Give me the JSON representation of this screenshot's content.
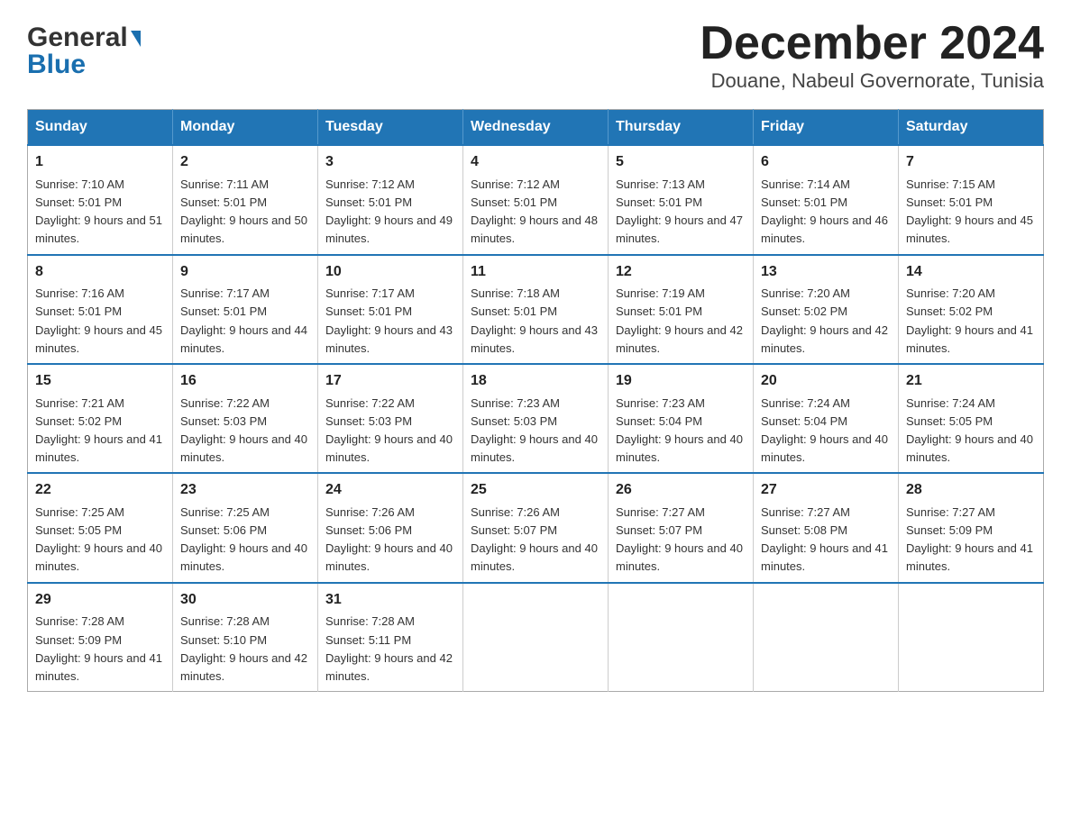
{
  "logo": {
    "line1": "General",
    "arrow": "▶",
    "line2": "Blue"
  },
  "title": "December 2024",
  "subtitle": "Douane, Nabeul Governorate, Tunisia",
  "weekdays": [
    "Sunday",
    "Monday",
    "Tuesday",
    "Wednesday",
    "Thursday",
    "Friday",
    "Saturday"
  ],
  "weeks": [
    [
      {
        "day": "1",
        "sunrise": "7:10 AM",
        "sunset": "5:01 PM",
        "daylight": "9 hours and 51 minutes."
      },
      {
        "day": "2",
        "sunrise": "7:11 AM",
        "sunset": "5:01 PM",
        "daylight": "9 hours and 50 minutes."
      },
      {
        "day": "3",
        "sunrise": "7:12 AM",
        "sunset": "5:01 PM",
        "daylight": "9 hours and 49 minutes."
      },
      {
        "day": "4",
        "sunrise": "7:12 AM",
        "sunset": "5:01 PM",
        "daylight": "9 hours and 48 minutes."
      },
      {
        "day": "5",
        "sunrise": "7:13 AM",
        "sunset": "5:01 PM",
        "daylight": "9 hours and 47 minutes."
      },
      {
        "day": "6",
        "sunrise": "7:14 AM",
        "sunset": "5:01 PM",
        "daylight": "9 hours and 46 minutes."
      },
      {
        "day": "7",
        "sunrise": "7:15 AM",
        "sunset": "5:01 PM",
        "daylight": "9 hours and 45 minutes."
      }
    ],
    [
      {
        "day": "8",
        "sunrise": "7:16 AM",
        "sunset": "5:01 PM",
        "daylight": "9 hours and 45 minutes."
      },
      {
        "day": "9",
        "sunrise": "7:17 AM",
        "sunset": "5:01 PM",
        "daylight": "9 hours and 44 minutes."
      },
      {
        "day": "10",
        "sunrise": "7:17 AM",
        "sunset": "5:01 PM",
        "daylight": "9 hours and 43 minutes."
      },
      {
        "day": "11",
        "sunrise": "7:18 AM",
        "sunset": "5:01 PM",
        "daylight": "9 hours and 43 minutes."
      },
      {
        "day": "12",
        "sunrise": "7:19 AM",
        "sunset": "5:01 PM",
        "daylight": "9 hours and 42 minutes."
      },
      {
        "day": "13",
        "sunrise": "7:20 AM",
        "sunset": "5:02 PM",
        "daylight": "9 hours and 42 minutes."
      },
      {
        "day": "14",
        "sunrise": "7:20 AM",
        "sunset": "5:02 PM",
        "daylight": "9 hours and 41 minutes."
      }
    ],
    [
      {
        "day": "15",
        "sunrise": "7:21 AM",
        "sunset": "5:02 PM",
        "daylight": "9 hours and 41 minutes."
      },
      {
        "day": "16",
        "sunrise": "7:22 AM",
        "sunset": "5:03 PM",
        "daylight": "9 hours and 40 minutes."
      },
      {
        "day": "17",
        "sunrise": "7:22 AM",
        "sunset": "5:03 PM",
        "daylight": "9 hours and 40 minutes."
      },
      {
        "day": "18",
        "sunrise": "7:23 AM",
        "sunset": "5:03 PM",
        "daylight": "9 hours and 40 minutes."
      },
      {
        "day": "19",
        "sunrise": "7:23 AM",
        "sunset": "5:04 PM",
        "daylight": "9 hours and 40 minutes."
      },
      {
        "day": "20",
        "sunrise": "7:24 AM",
        "sunset": "5:04 PM",
        "daylight": "9 hours and 40 minutes."
      },
      {
        "day": "21",
        "sunrise": "7:24 AM",
        "sunset": "5:05 PM",
        "daylight": "9 hours and 40 minutes."
      }
    ],
    [
      {
        "day": "22",
        "sunrise": "7:25 AM",
        "sunset": "5:05 PM",
        "daylight": "9 hours and 40 minutes."
      },
      {
        "day": "23",
        "sunrise": "7:25 AM",
        "sunset": "5:06 PM",
        "daylight": "9 hours and 40 minutes."
      },
      {
        "day": "24",
        "sunrise": "7:26 AM",
        "sunset": "5:06 PM",
        "daylight": "9 hours and 40 minutes."
      },
      {
        "day": "25",
        "sunrise": "7:26 AM",
        "sunset": "5:07 PM",
        "daylight": "9 hours and 40 minutes."
      },
      {
        "day": "26",
        "sunrise": "7:27 AM",
        "sunset": "5:07 PM",
        "daylight": "9 hours and 40 minutes."
      },
      {
        "day": "27",
        "sunrise": "7:27 AM",
        "sunset": "5:08 PM",
        "daylight": "9 hours and 41 minutes."
      },
      {
        "day": "28",
        "sunrise": "7:27 AM",
        "sunset": "5:09 PM",
        "daylight": "9 hours and 41 minutes."
      }
    ],
    [
      {
        "day": "29",
        "sunrise": "7:28 AM",
        "sunset": "5:09 PM",
        "daylight": "9 hours and 41 minutes."
      },
      {
        "day": "30",
        "sunrise": "7:28 AM",
        "sunset": "5:10 PM",
        "daylight": "9 hours and 42 minutes."
      },
      {
        "day": "31",
        "sunrise": "7:28 AM",
        "sunset": "5:11 PM",
        "daylight": "9 hours and 42 minutes."
      },
      null,
      null,
      null,
      null
    ]
  ],
  "labels": {
    "sunrise": "Sunrise:",
    "sunset": "Sunset:",
    "daylight": "Daylight:"
  }
}
